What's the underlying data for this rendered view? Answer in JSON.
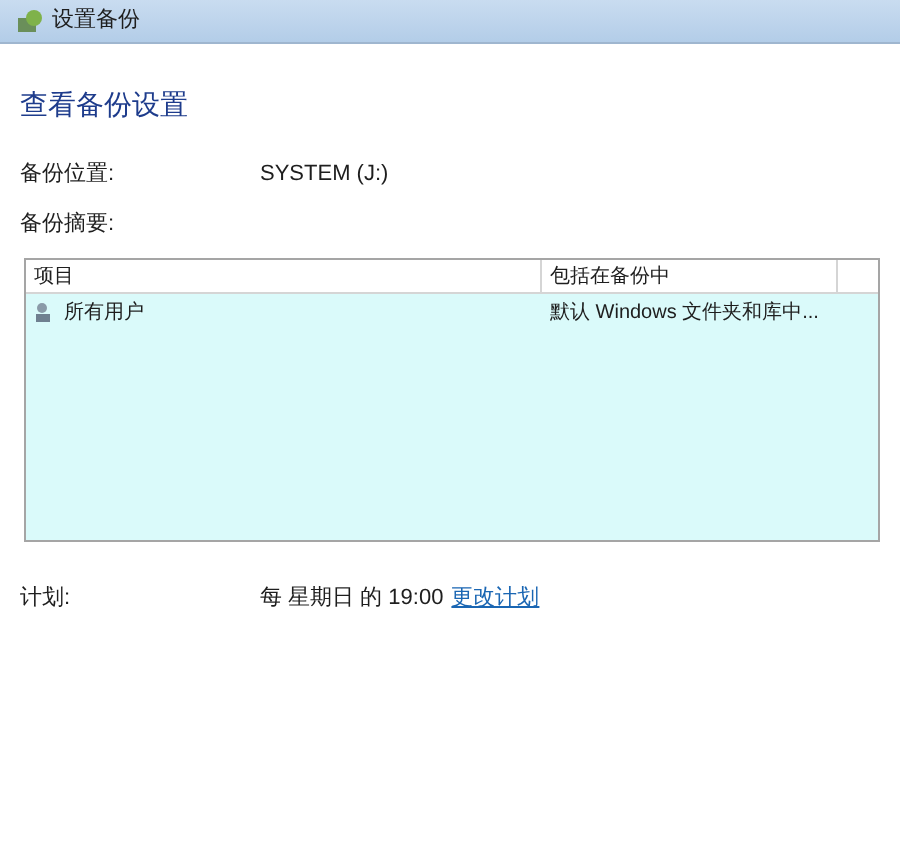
{
  "window": {
    "title": "设置备份"
  },
  "heading": "查看备份设置",
  "fields": [
    {
      "label": "备份位置:",
      "value": "SYSTEM (J:)"
    },
    {
      "label": "备份摘要:"
    }
  ],
  "table": {
    "columns": [
      "项目",
      "包括在备份中"
    ],
    "rows": [
      {
        "cells": [
          "所有用户",
          "默认 Windows 文件夹和库中..."
        ]
      }
    ]
  },
  "schedule": {
    "label": "计划:",
    "value": "每 星期日 的 19:00",
    "link": "更改计划"
  }
}
